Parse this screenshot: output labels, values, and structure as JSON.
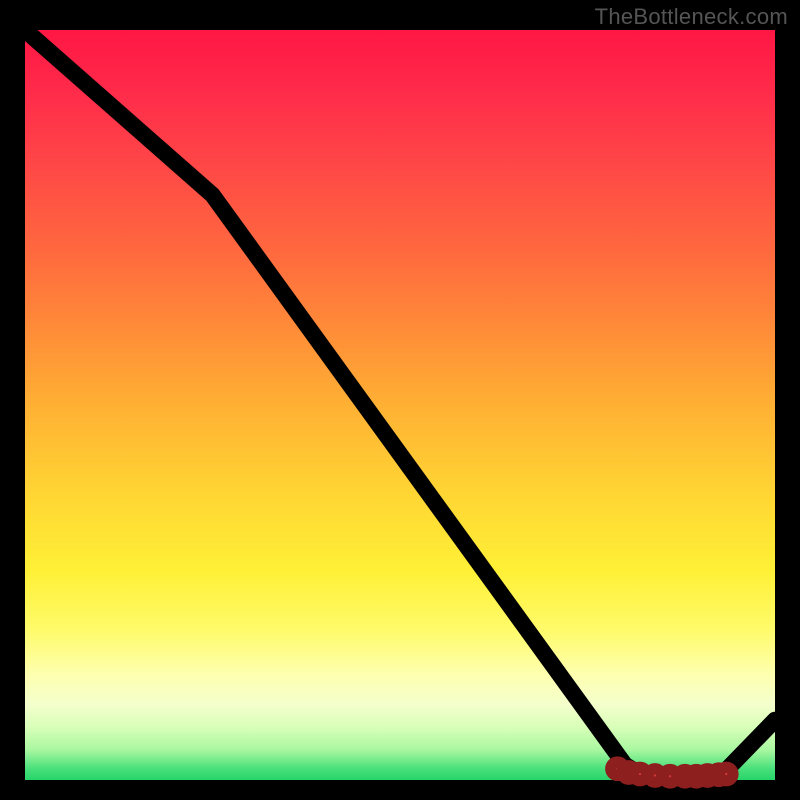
{
  "watermark": "TheBottleneck.com",
  "chart_data": {
    "type": "line",
    "title": "",
    "xlabel": "",
    "ylabel": "",
    "xlim": [
      0,
      100
    ],
    "ylim": [
      0,
      100
    ],
    "series": [
      {
        "name": "curve",
        "x": [
          0,
          25,
          80,
          82,
          90,
          93,
          100
        ],
        "values": [
          100,
          78,
          2,
          0.8,
          0.5,
          0.8,
          8
        ]
      }
    ],
    "markers": {
      "name": "highlight",
      "x": [
        79,
        80.5,
        82,
        84,
        86,
        88,
        89.5,
        91,
        92.5,
        93.5
      ],
      "values": [
        1.5,
        1.0,
        0.8,
        0.6,
        0.5,
        0.5,
        0.5,
        0.6,
        0.7,
        0.8
      ]
    },
    "background_gradient": {
      "top": "#ff1744",
      "mid": "#ffd633",
      "bottom": "#25d56a"
    }
  }
}
